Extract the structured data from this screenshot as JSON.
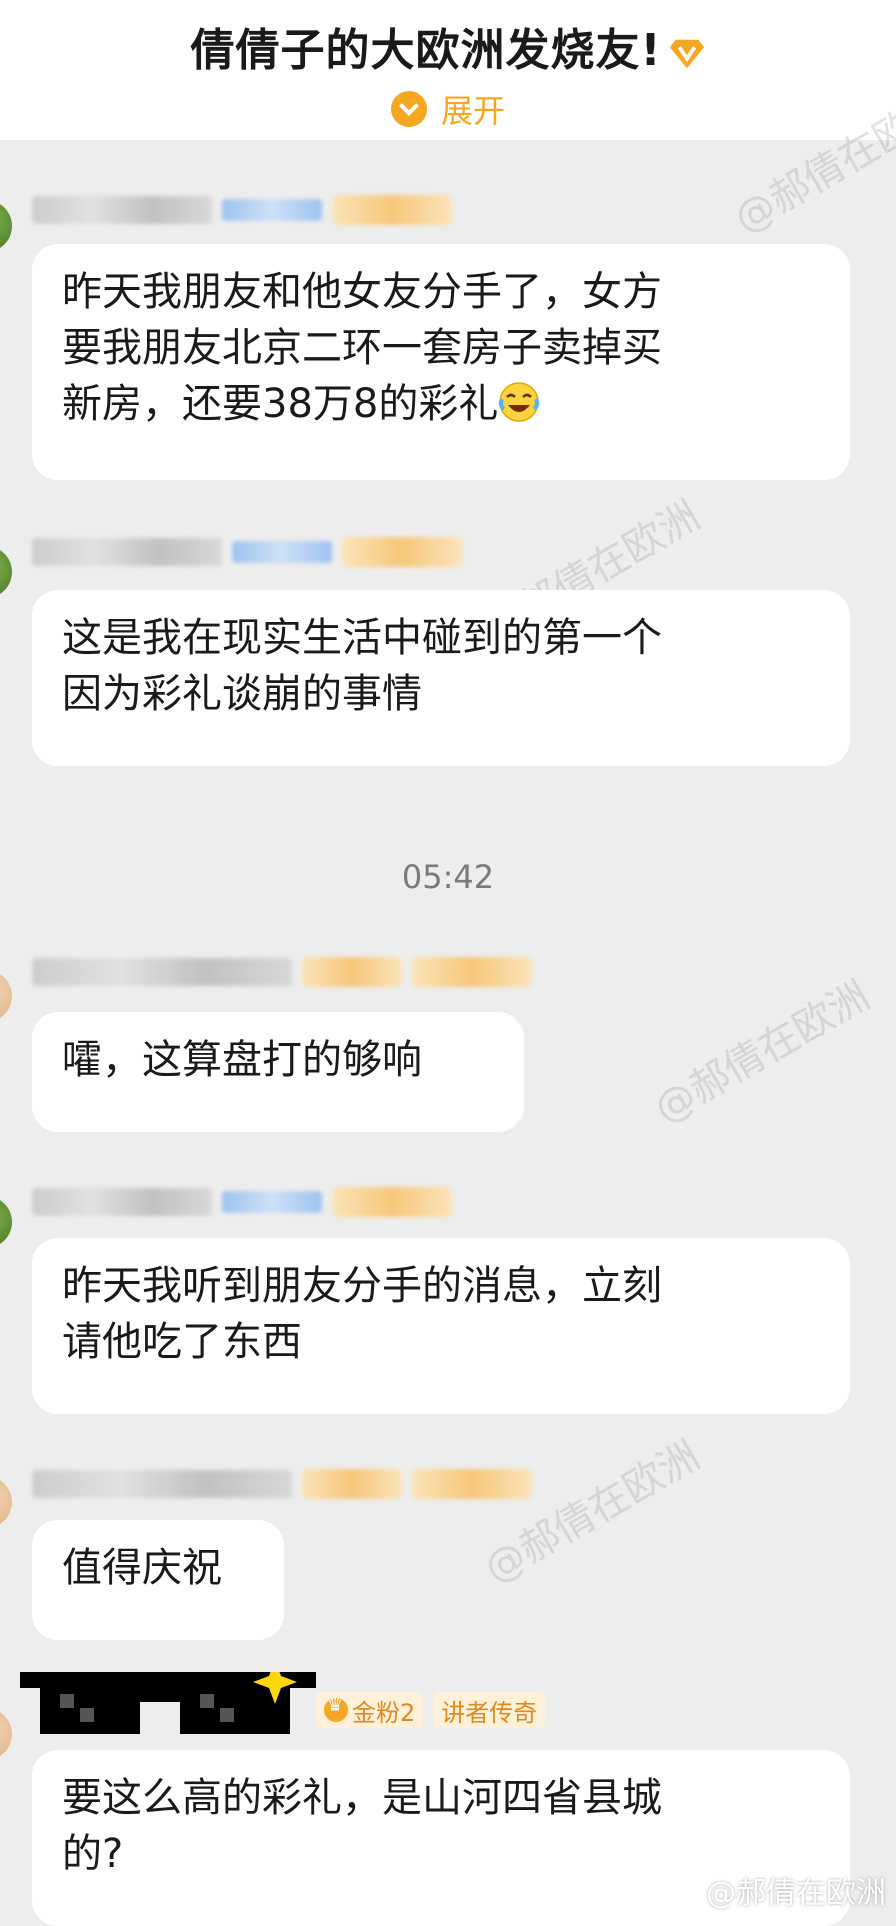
{
  "header": {
    "title": "倩倩子的大欧洲发烧友!",
    "badge_icon": "vip-v-badge-icon",
    "expand_label": "展开",
    "expand_icon": "chevron-down-circle-icon",
    "accent_color": "#f5a623"
  },
  "messages": [
    {
      "text": "昨天我朋友和他女友分手了，女方\n要我朋友北京二环一套房子卖掉买\n新房，还要38万8的彩礼",
      "emoji": "laughing-crying-face"
    },
    {
      "text": "这是我在现实生活中碰到的第一个\n因为彩礼谈崩的事情"
    },
    {
      "text": "嚯，这算盘打的够响"
    },
    {
      "text": "昨天我听到朋友分手的消息，立刻\n请他吃了东西"
    },
    {
      "text": "值得庆祝"
    },
    {
      "text": "要这么高的彩礼，是山河四省县城\n的?"
    }
  ],
  "timestamp": "05:42",
  "last_badges": {
    "fan_level": "金粉2",
    "title": "讲者传奇"
  },
  "watermark": "@郝倩在欧洲",
  "footer_watermark": "@郝倩在欧洲"
}
